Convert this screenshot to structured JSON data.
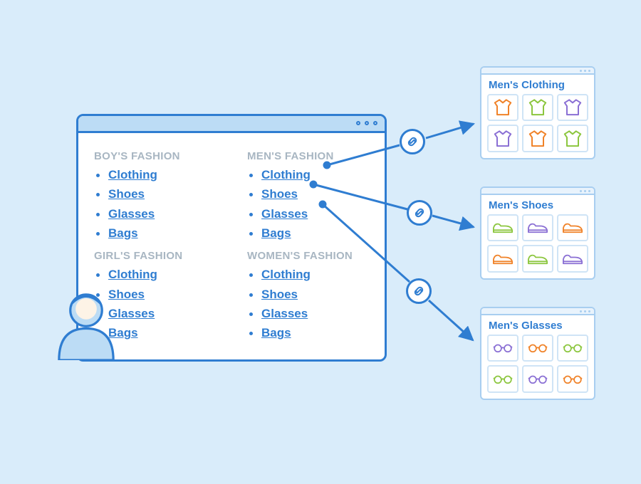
{
  "main": {
    "sections": [
      {
        "heading": "BOY'S FASHION",
        "items": [
          "Clothing",
          "Shoes",
          "Glasses",
          "Bags"
        ]
      },
      {
        "heading": "GIRL'S FASHION",
        "items": [
          "Clothing",
          "Shoes",
          "Glasses",
          "Bags"
        ]
      },
      {
        "heading": "MEN'S FASHION",
        "items": [
          "Clothing",
          "Shoes",
          "Glasses",
          "Bags"
        ]
      },
      {
        "heading": "WOMEN'S FASHION",
        "items": [
          "Clothing",
          "Shoes",
          "Glasses",
          "Bags"
        ]
      }
    ]
  },
  "minis": [
    {
      "title": "Men's Clothing",
      "icon_type": "shirt",
      "colors": [
        "orange",
        "green",
        "purple",
        "purple",
        "orange",
        "green"
      ]
    },
    {
      "title": "Men's Shoes",
      "icon_type": "shoe",
      "colors": [
        "green",
        "purple",
        "orange",
        "orange",
        "green",
        "purple"
      ]
    },
    {
      "title": "Men's Glasses",
      "icon_type": "glasses",
      "colors": [
        "purple",
        "orange",
        "green",
        "green",
        "purple",
        "orange"
      ]
    }
  ],
  "colors": {
    "orange": "#f08228",
    "green": "#8cc63e",
    "purple": "#8a6fd4",
    "primary": "#2f7dd1"
  },
  "icon_name": {
    "link_badge": "link-icon",
    "avatar": "user-avatar"
  }
}
